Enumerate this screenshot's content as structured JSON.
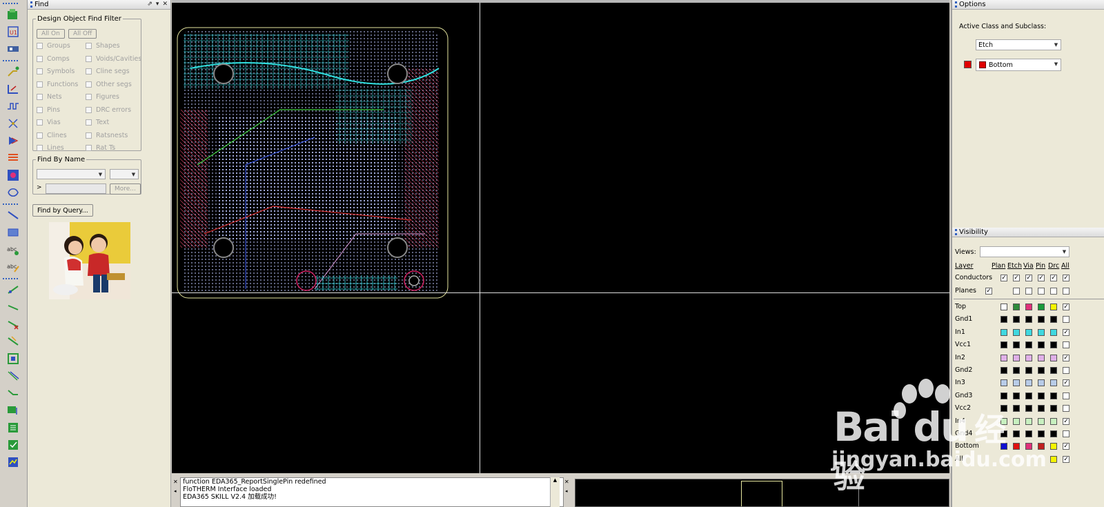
{
  "find_panel": {
    "title": "Find",
    "controls": [
      "⇗",
      "▾",
      "✕"
    ],
    "filter_group_title": "Design Object Find Filter",
    "all_on": "All On",
    "all_off": "All Off",
    "filters_left": [
      "Groups",
      "Comps",
      "Symbols",
      "Functions",
      "Nets",
      "Pins",
      "Vias",
      "Clines",
      "Lines"
    ],
    "filters_right": [
      "Shapes",
      "Voids/Cavities",
      "Cline segs",
      "Other segs",
      "Figures",
      "DRC errors",
      "Text",
      "Ratsnests",
      "Rat Ts"
    ],
    "find_by_name_title": "Find By Name",
    "name_prefix": ">",
    "more_label": "More...",
    "find_by_query": "Find by Query..."
  },
  "console": {
    "lines": [
      "function EDA365_ReportSinglePin redefined",
      "FloTHERM Interface loaded",
      "EDA365 SKILL V2.4 加载成功!"
    ]
  },
  "options_panel": {
    "title": "Options",
    "active_class_label": "Active Class and Subclass:",
    "class_value": "Etch",
    "subclass_value": "Bottom",
    "subclass_color": "#e00000"
  },
  "visibility_panel": {
    "title": "Visibility",
    "views_label": "Views:",
    "columns": [
      "Layer",
      "Plan",
      "Etch",
      "Via",
      "Pin",
      "Drc",
      "All"
    ],
    "group_rows": [
      {
        "name": "Conductors",
        "plan": true,
        "checks": [
          true,
          true,
          true,
          true,
          true
        ]
      },
      {
        "name": "Planes",
        "plan": true,
        "checks": [
          false,
          false,
          false,
          false,
          false
        ]
      }
    ],
    "layers": [
      {
        "name": "Top",
        "colors": [
          "#ffffff",
          "#2e8b3a",
          "#e0307a",
          "#1a9a3a",
          "#f5f500"
        ],
        "all": true
      },
      {
        "name": "Gnd1",
        "colors": [
          "#000000",
          "#000000",
          "#000000",
          "#000000",
          "#000000"
        ],
        "all": false
      },
      {
        "name": "In1",
        "colors": [
          "#40d8e0",
          "#40d8e0",
          "#40d8e0",
          "#40d8e0",
          "#40d8e0"
        ],
        "all": true
      },
      {
        "name": "Vcc1",
        "colors": [
          "#000000",
          "#000000",
          "#000000",
          "#000000",
          "#000000"
        ],
        "all": false
      },
      {
        "name": "In2",
        "colors": [
          "#e0b0e8",
          "#e0b0e8",
          "#e0b0e8",
          "#e0b0e8",
          "#e0b0e8"
        ],
        "all": true
      },
      {
        "name": "Gnd2",
        "colors": [
          "#000000",
          "#000000",
          "#000000",
          "#000000",
          "#000000"
        ],
        "all": false
      },
      {
        "name": "In3",
        "colors": [
          "#b8cce8",
          "#b8cce8",
          "#b8cce8",
          "#b8cce8",
          "#b8cce8"
        ],
        "all": true
      },
      {
        "name": "Gnd3",
        "colors": [
          "#000000",
          "#000000",
          "#000000",
          "#000000",
          "#000000"
        ],
        "all": false
      },
      {
        "name": "Vcc2",
        "colors": [
          "#000000",
          "#000000",
          "#000000",
          "#000000",
          "#000000"
        ],
        "all": false
      },
      {
        "name": "In4",
        "colors": [
          "#c8f0c0",
          "#c8f0c0",
          "#c8f0c0",
          "#c8f0c0",
          "#c8f0c0"
        ],
        "all": true
      },
      {
        "name": "Gnd4",
        "colors": [
          "#000000",
          "#000000",
          "#000000",
          "#000000",
          "#000000"
        ],
        "all": false
      },
      {
        "name": "Bottom",
        "colors": [
          "#1010d0",
          "#e01010",
          "#e0307a",
          "#c02020",
          "#f5f500"
        ],
        "all": true
      },
      {
        "name": "All",
        "colors": [
          "",
          "",
          "",
          "",
          "#f5f500"
        ],
        "all": true
      }
    ]
  },
  "watermark": {
    "brand": "Bai  du",
    "cn": "经验",
    "domain": "jingyan.baidu.com"
  }
}
